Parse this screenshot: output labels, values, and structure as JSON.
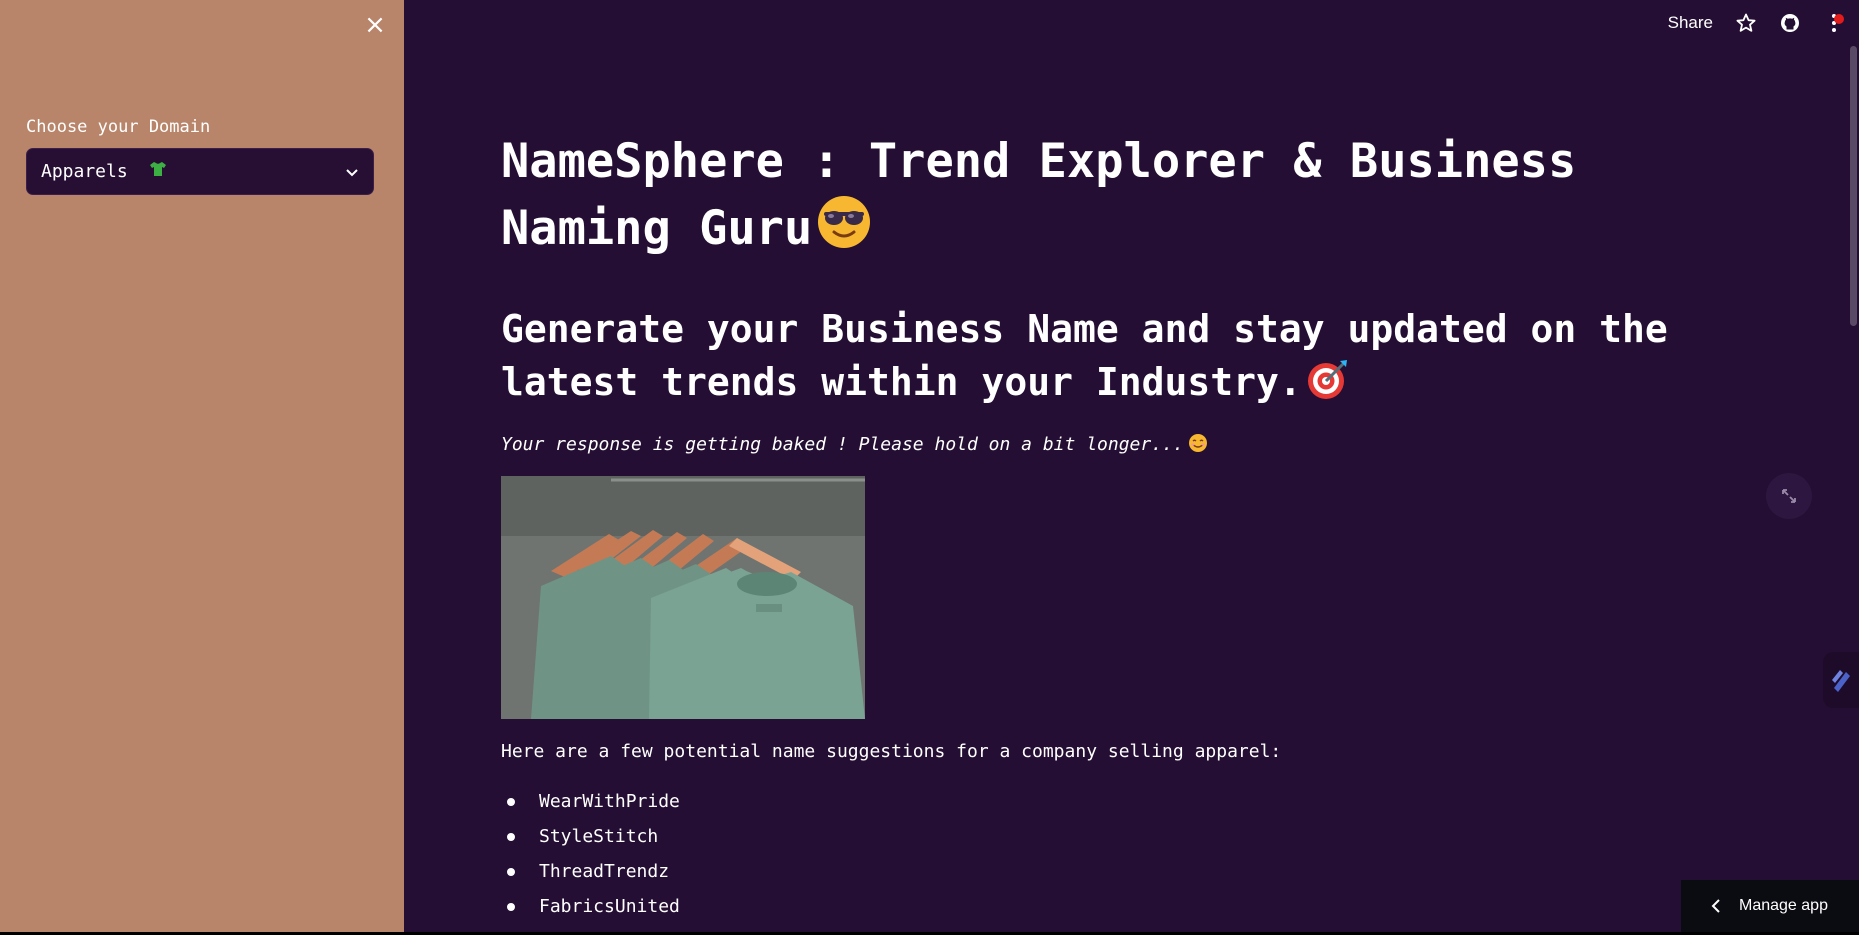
{
  "sidebar": {
    "domain_label": "Choose your Domain",
    "domain_selected": "Apparels",
    "domain_icon": "tshirt-icon"
  },
  "topbar": {
    "share_label": "Share",
    "icons": [
      "star-icon",
      "github-icon",
      "more-menu-icon"
    ]
  },
  "main": {
    "title": "NameSphere : Trend Explorer & Business Naming Guru",
    "title_emoji": "sunglasses-emoji",
    "subtitle": "Generate your Business Name and stay updated on the latest trends within your Industry.",
    "subtitle_emoji": "target-emoji",
    "status_text": "Your response is getting baked ! Please hold on a bit longer...",
    "status_emoji": "smile-emoji",
    "image_subject": "green t-shirts on wooden hangers",
    "intro_text": "Here are a few potential name suggestions for a company selling apparel:",
    "name_suggestions": [
      "WearWithPride",
      "StyleStitch",
      "ThreadTrendz",
      "FabricsUnited"
    ]
  },
  "footer": {
    "manage_app_label": "Manage app"
  },
  "colors": {
    "sidebar_bg": "#b8856a",
    "main_bg": "#250e33",
    "select_bg": "#260f33"
  }
}
